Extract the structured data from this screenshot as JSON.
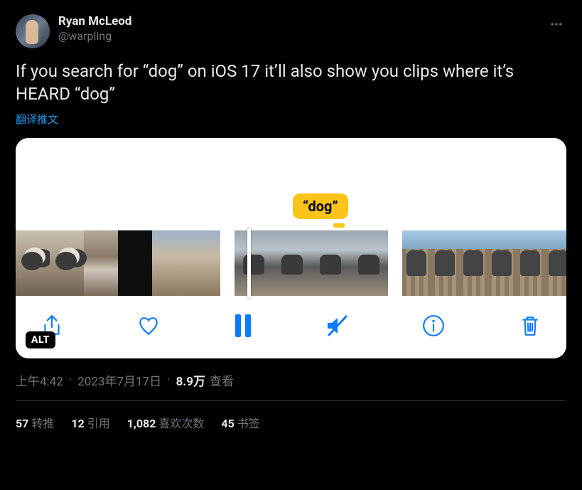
{
  "author": {
    "display_name": "Ryan McLeod",
    "handle": "@warpling"
  },
  "tweet_text": "If you search for “dog” on iOS 17 it’ll also show you clips where it’s HEARD “dog”",
  "translate_label": "翻译推文",
  "media": {
    "caption_bubble": "“dog”",
    "alt_badge": "ALT",
    "toolbar_icons": [
      "share-icon",
      "heart-icon",
      "pause-icon",
      "mute-icon",
      "info-icon",
      "trash-icon"
    ]
  },
  "meta": {
    "time": "上午4:42",
    "date": "2023年7月17日",
    "views_count": "8.9万",
    "views_label": "查看"
  },
  "stats": {
    "retweets": {
      "count": "57",
      "label": "转推"
    },
    "quotes": {
      "count": "12",
      "label": "引用"
    },
    "likes": {
      "count": "1,082",
      "label": "喜欢次数"
    },
    "bookmarks": {
      "count": "45",
      "label": "书签"
    }
  }
}
